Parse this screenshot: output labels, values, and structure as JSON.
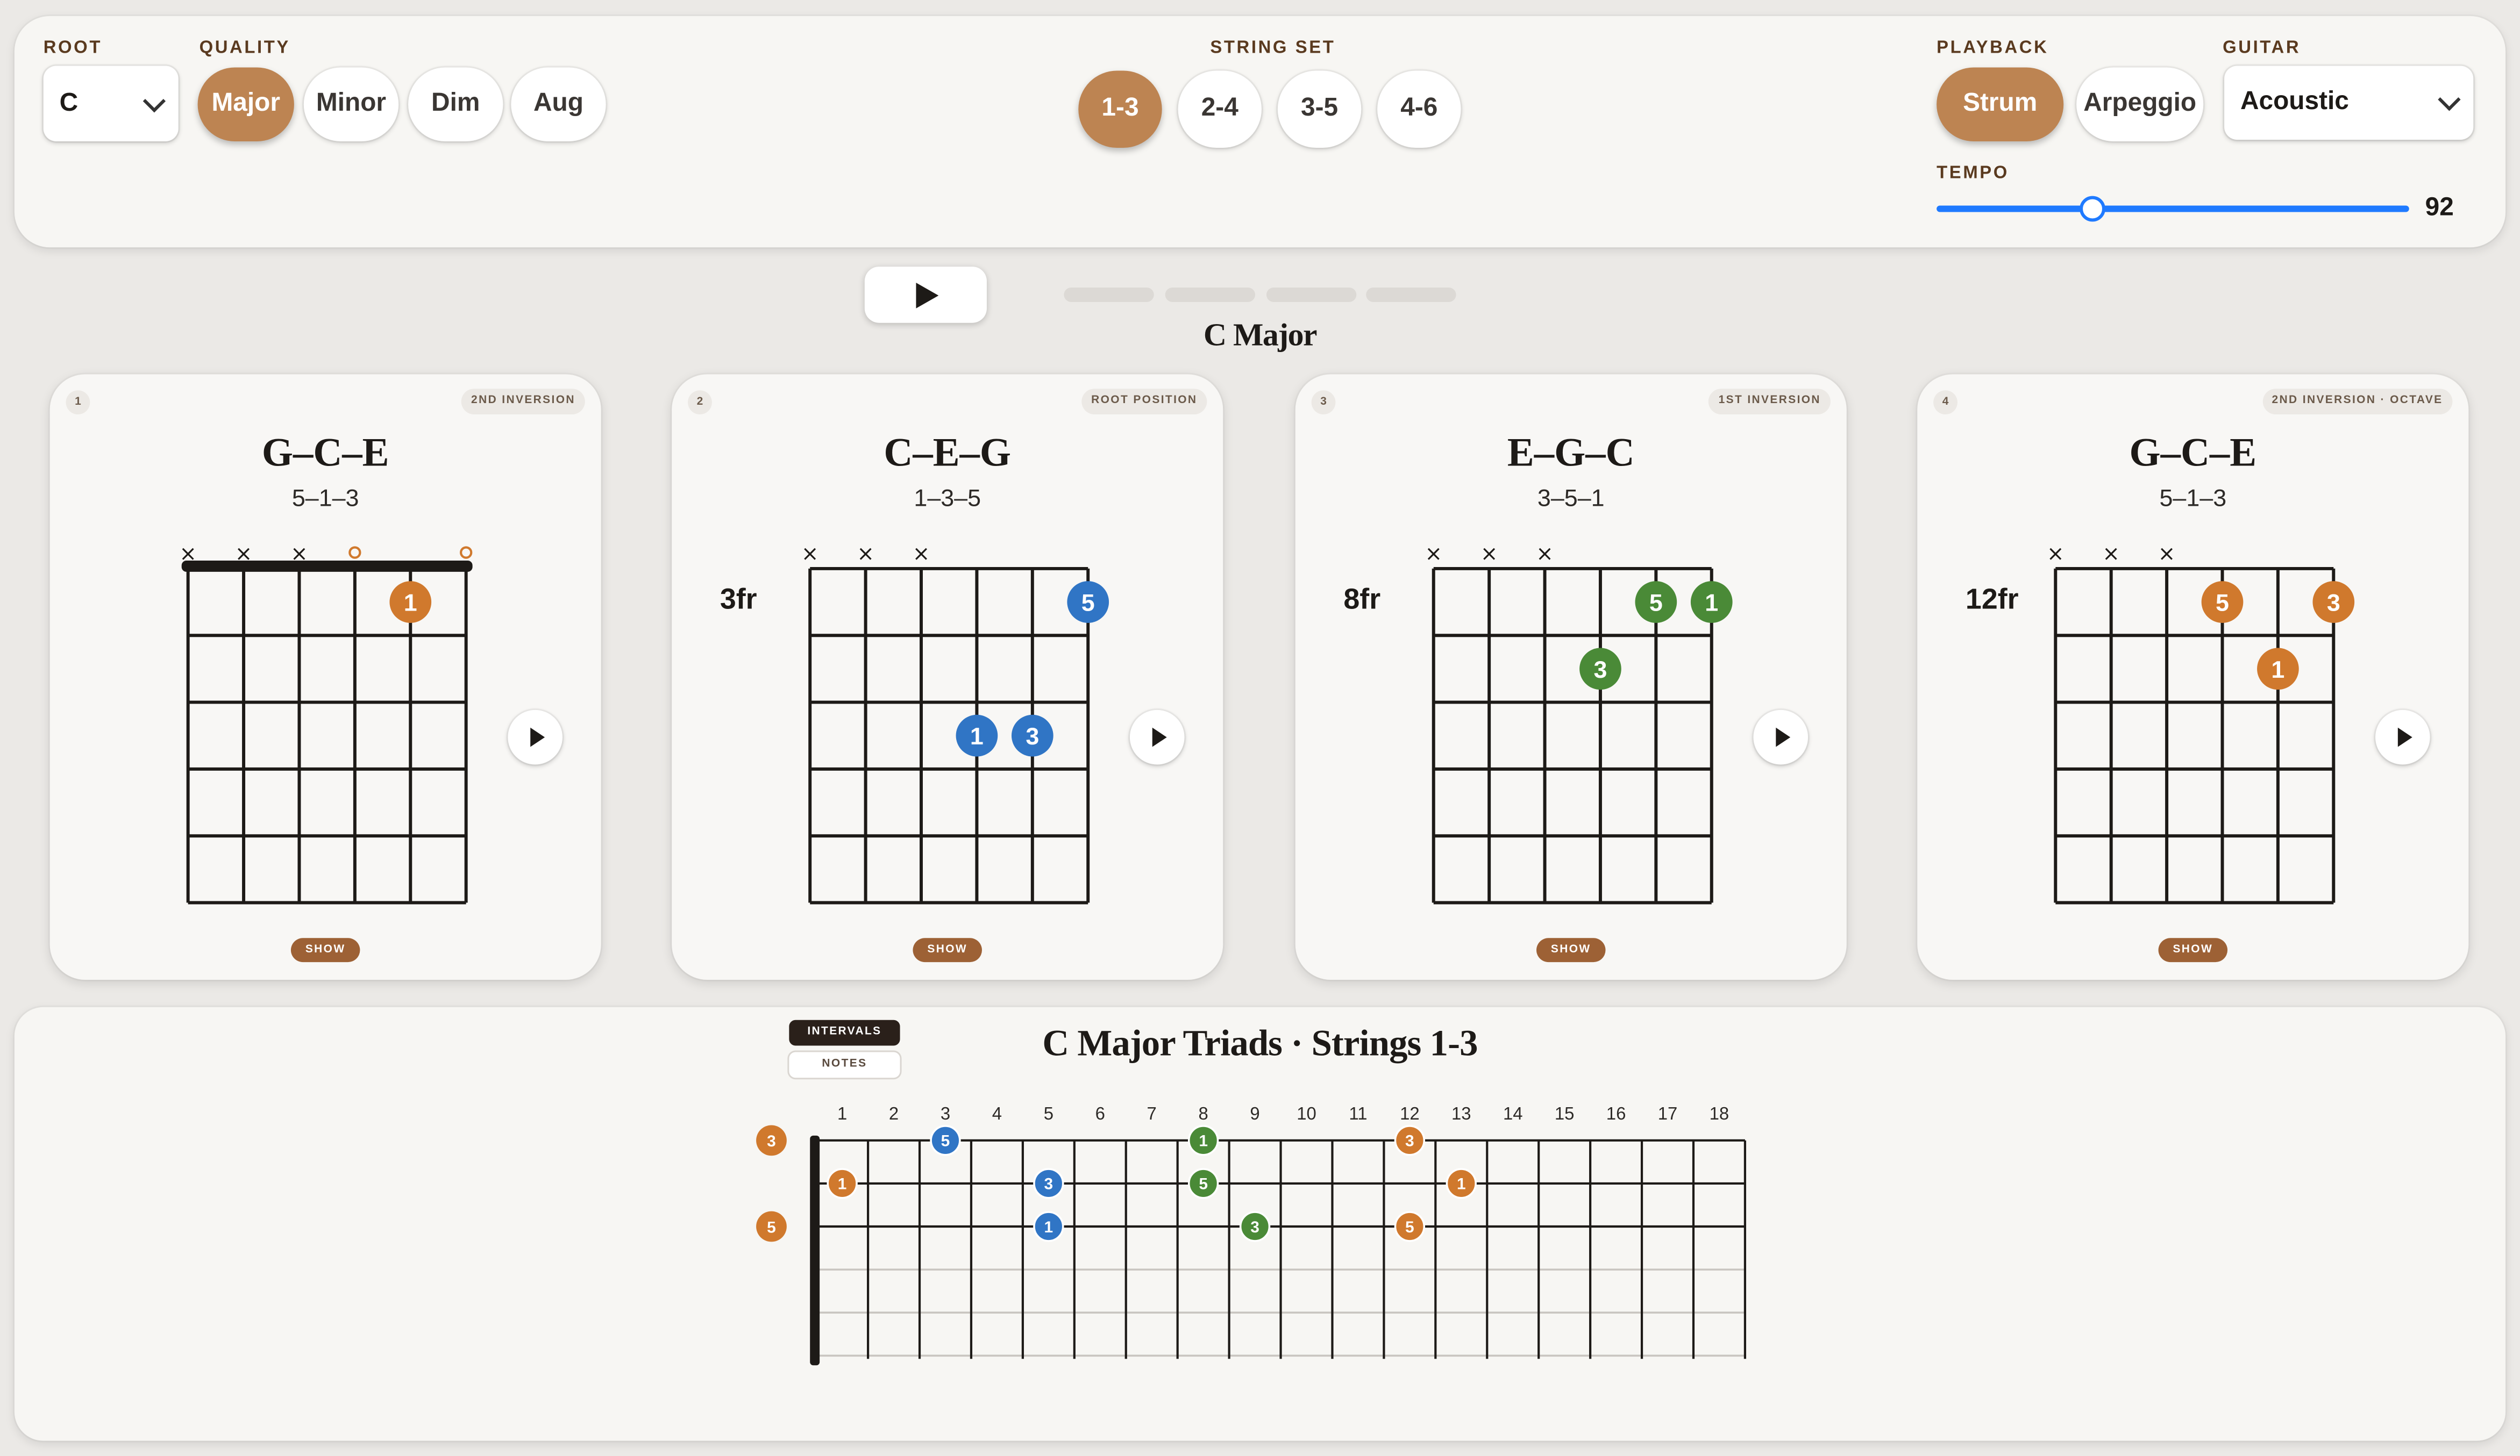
{
  "controls": {
    "root_label": "ROOT",
    "root_value": "C",
    "quality_label": "QUALITY",
    "qualities": [
      "Major",
      "Minor",
      "Dim",
      "Aug"
    ],
    "quality_selected": "Major",
    "string_set_label": "STRING SET",
    "string_sets": [
      "1-3",
      "2-4",
      "3-5",
      "4-6"
    ],
    "string_set_selected": "1-3",
    "playback_label": "PLAYBACK",
    "playback_modes": [
      "Strum",
      "Arpeggio"
    ],
    "playback_selected": "Strum",
    "guitar_label": "GUITAR",
    "guitar_value": "Acoustic",
    "tempo_label": "TEMPO",
    "tempo_value": "92",
    "tempo_fraction": 0.33
  },
  "sequence": {
    "chord_title": "C Major",
    "progress_segments": 4
  },
  "colors": {
    "root_dot": "#d0792d",
    "third_dot": "#d0792d",
    "fifth_dot": "#d0792d",
    "blue_dot": "#3075c5",
    "green_dot": "#4a8a37",
    "accent": "#bd8452",
    "show_button": "#9d6135"
  },
  "cards": [
    {
      "index": "1",
      "badge": "2ND INVERSION",
      "name": "G–C–E",
      "formula": "5–1–3",
      "fret_label": "",
      "show_label": "SHOW",
      "nut": true,
      "string_marks": [
        "×",
        "×",
        "×",
        "○",
        "",
        "○"
      ],
      "dots": [
        {
          "string": 5,
          "fret": 1,
          "label": "1",
          "color": "orange"
        }
      ]
    },
    {
      "index": "2",
      "badge": "ROOT POSITION",
      "name": "C–E–G",
      "formula": "1–3–5",
      "fret_label": "3fr",
      "show_label": "SHOW",
      "nut": false,
      "string_marks": [
        "×",
        "×",
        "×",
        "",
        "",
        ""
      ],
      "dots": [
        {
          "string": 6,
          "fret": 1,
          "label": "5",
          "color": "blue"
        },
        {
          "string": 4,
          "fret": 3,
          "label": "1",
          "color": "blue"
        },
        {
          "string": 5,
          "fret": 3,
          "label": "3",
          "color": "blue"
        }
      ]
    },
    {
      "index": "3",
      "badge": "1ST INVERSION",
      "name": "E–G–C",
      "formula": "3–5–1",
      "fret_label": "8fr",
      "show_label": "SHOW",
      "nut": false,
      "string_marks": [
        "×",
        "×",
        "×",
        "",
        "",
        ""
      ],
      "dots": [
        {
          "string": 5,
          "fret": 1,
          "label": "5",
          "color": "green"
        },
        {
          "string": 6,
          "fret": 1,
          "label": "1",
          "color": "green"
        },
        {
          "string": 4,
          "fret": 2,
          "label": "3",
          "color": "green"
        }
      ]
    },
    {
      "index": "4",
      "badge": "2ND INVERSION · OCTAVE",
      "name": "G–C–E",
      "formula": "5–1–3",
      "fret_label": "12fr",
      "show_label": "SHOW",
      "nut": false,
      "string_marks": [
        "×",
        "×",
        "×",
        "",
        "",
        ""
      ],
      "dots": [
        {
          "string": 4,
          "fret": 1,
          "label": "5",
          "color": "orange"
        },
        {
          "string": 6,
          "fret": 1,
          "label": "3",
          "color": "orange"
        },
        {
          "string": 5,
          "fret": 2,
          "label": "1",
          "color": "orange"
        }
      ]
    }
  ],
  "neck": {
    "title": "C Major Triads · Strings 1-3",
    "toggle_intervals": "INTERVALS",
    "toggle_notes": "NOTES",
    "toggle_selected": "INTERVALS",
    "fret_numbers": [
      "1",
      "2",
      "3",
      "4",
      "5",
      "6",
      "7",
      "8",
      "9",
      "10",
      "11",
      "12",
      "13",
      "14",
      "15",
      "16",
      "17",
      "18"
    ],
    "open_dots": [
      {
        "string": 1,
        "label": "3",
        "color": "orange"
      },
      {
        "string": 3,
        "label": "5",
        "color": "orange"
      }
    ],
    "dots": [
      {
        "string": 1,
        "fret": 3,
        "label": "5",
        "color": "blue"
      },
      {
        "string": 1,
        "fret": 8,
        "label": "1",
        "color": "green"
      },
      {
        "string": 1,
        "fret": 12,
        "label": "3",
        "color": "orange"
      },
      {
        "string": 2,
        "fret": 1,
        "label": "1",
        "color": "orange"
      },
      {
        "string": 2,
        "fret": 5,
        "label": "3",
        "color": "blue"
      },
      {
        "string": 2,
        "fret": 8,
        "label": "5",
        "color": "green"
      },
      {
        "string": 2,
        "fret": 13,
        "label": "1",
        "color": "orange"
      },
      {
        "string": 3,
        "fret": 5,
        "label": "1",
        "color": "blue"
      },
      {
        "string": 3,
        "fret": 9,
        "label": "3",
        "color": "green"
      },
      {
        "string": 3,
        "fret": 12,
        "label": "5",
        "color": "orange"
      }
    ]
  }
}
